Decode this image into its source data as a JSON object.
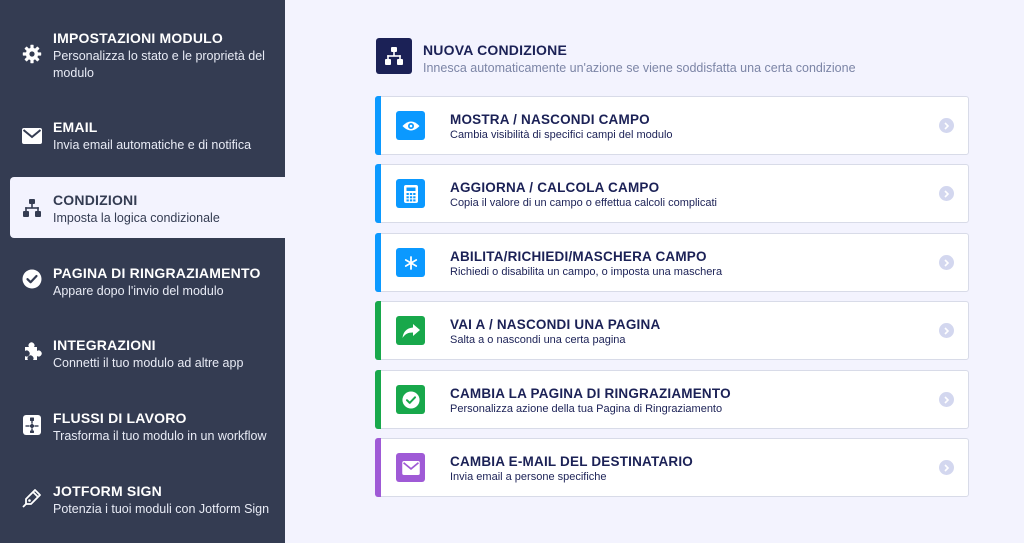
{
  "sidebar": {
    "items": [
      {
        "icon": "gear-icon",
        "title": "IMPOSTAZIONI MODULO",
        "subtitle": "Personalizza lo stato e le proprietà del modulo"
      },
      {
        "icon": "envelope-icon",
        "title": "EMAIL",
        "subtitle": "Invia email automatiche e di notifica"
      },
      {
        "icon": "sitemap-icon",
        "title": "CONDIZIONI",
        "subtitle": "Imposta la logica condizionale"
      },
      {
        "icon": "check-circle-icon",
        "title": "PAGINA DI RINGRAZIAMENTO",
        "subtitle": "Appare dopo l'invio del modulo"
      },
      {
        "icon": "puzzle-icon",
        "title": "INTEGRAZIONI",
        "subtitle": "Connetti il tuo modulo ad altre app"
      },
      {
        "icon": "workflow-icon",
        "title": "FLUSSI DI LAVORO",
        "subtitle": "Trasforma il tuo modulo in un workflow"
      },
      {
        "icon": "pen-icon",
        "title": "JOTFORM SIGN",
        "subtitle": "Potenzia i tuoi moduli con Jotform Sign"
      }
    ]
  },
  "header": {
    "title": "NUOVA CONDIZIONE",
    "subtitle": "Innesca automaticamente un'azione se viene soddisfatta una certa condizione"
  },
  "colors": {
    "sidebar_bg": "#343c52",
    "page_bg": "#f3f3fe",
    "navy": "#1b2156",
    "blue": "#0b99ff",
    "green": "#18a84b",
    "purple": "#9f5ad6"
  },
  "cards": [
    {
      "icon": "eye-icon",
      "title": "MOSTRA / NASCONDI CAMPO",
      "subtitle": "Cambia visibilità di specifici campi del modulo",
      "color": "#0b99ff"
    },
    {
      "icon": "calculator-icon",
      "title": "AGGIORNA / CALCOLA CAMPO",
      "subtitle": "Copia il valore di un campo o effettua calcoli complicati",
      "color": "#0b99ff"
    },
    {
      "icon": "asterisk-icon",
      "title": "ABILITA/RICHIEDI/MASCHERA CAMPO",
      "subtitle": "Richiedi o disabilita un campo, o imposta una maschera",
      "color": "#0b99ff"
    },
    {
      "icon": "share-arrow-icon",
      "title": "VAI A / NASCONDI UNA PAGINA",
      "subtitle": "Salta a o nascondi una certa pagina",
      "color": "#18a84b"
    },
    {
      "icon": "check-circle-icon",
      "title": "CAMBIA LA PAGINA DI RINGRAZIAMENTO",
      "subtitle": "Personalizza azione della tua Pagina di Ringraziamento",
      "color": "#18a84b"
    },
    {
      "icon": "envelope-icon",
      "title": "CAMBIA E-MAIL DEL DESTINATARIO",
      "subtitle": "Invia email a persone specifiche",
      "color": "#9f5ad6"
    }
  ]
}
